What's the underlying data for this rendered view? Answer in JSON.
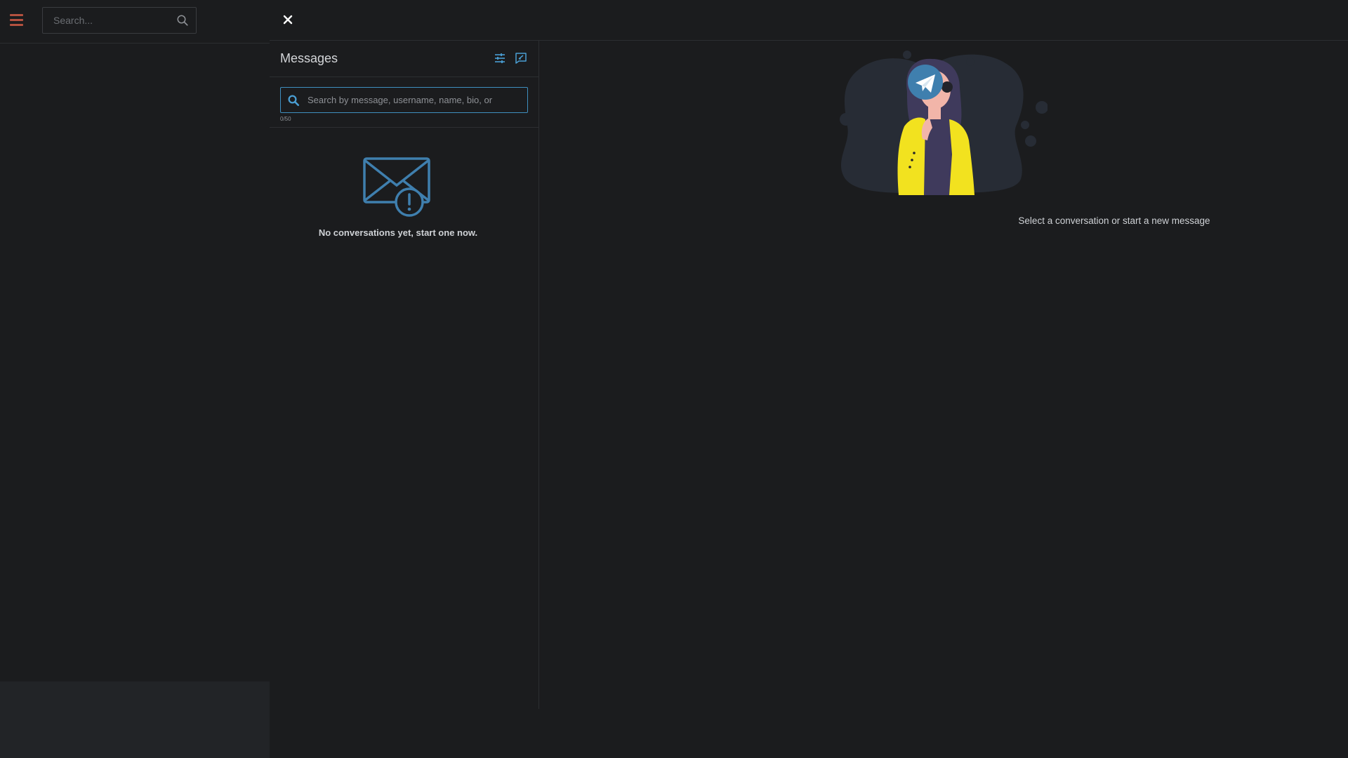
{
  "left_app": {
    "search_placeholder": "Search..."
  },
  "messages": {
    "title": "Messages",
    "search_placeholder": "Search by message, username, name, bio, or",
    "char_count": "0/50",
    "empty_text": "No conversations yet, start one now."
  },
  "detail": {
    "prompt": "Select a conversation or start a new message"
  },
  "colors": {
    "background": "#1b1c1e",
    "accent_blue": "#3f8fbf",
    "hamburger_red": "#b4513f",
    "illustration_yellow": "#f2e21f"
  },
  "icons": {
    "menu": "hamburger-menu-icon",
    "search": "search-icon",
    "close": "close-icon",
    "filter": "sliders-icon",
    "compose": "compose-message-icon",
    "empty": "envelope-alert-icon"
  }
}
